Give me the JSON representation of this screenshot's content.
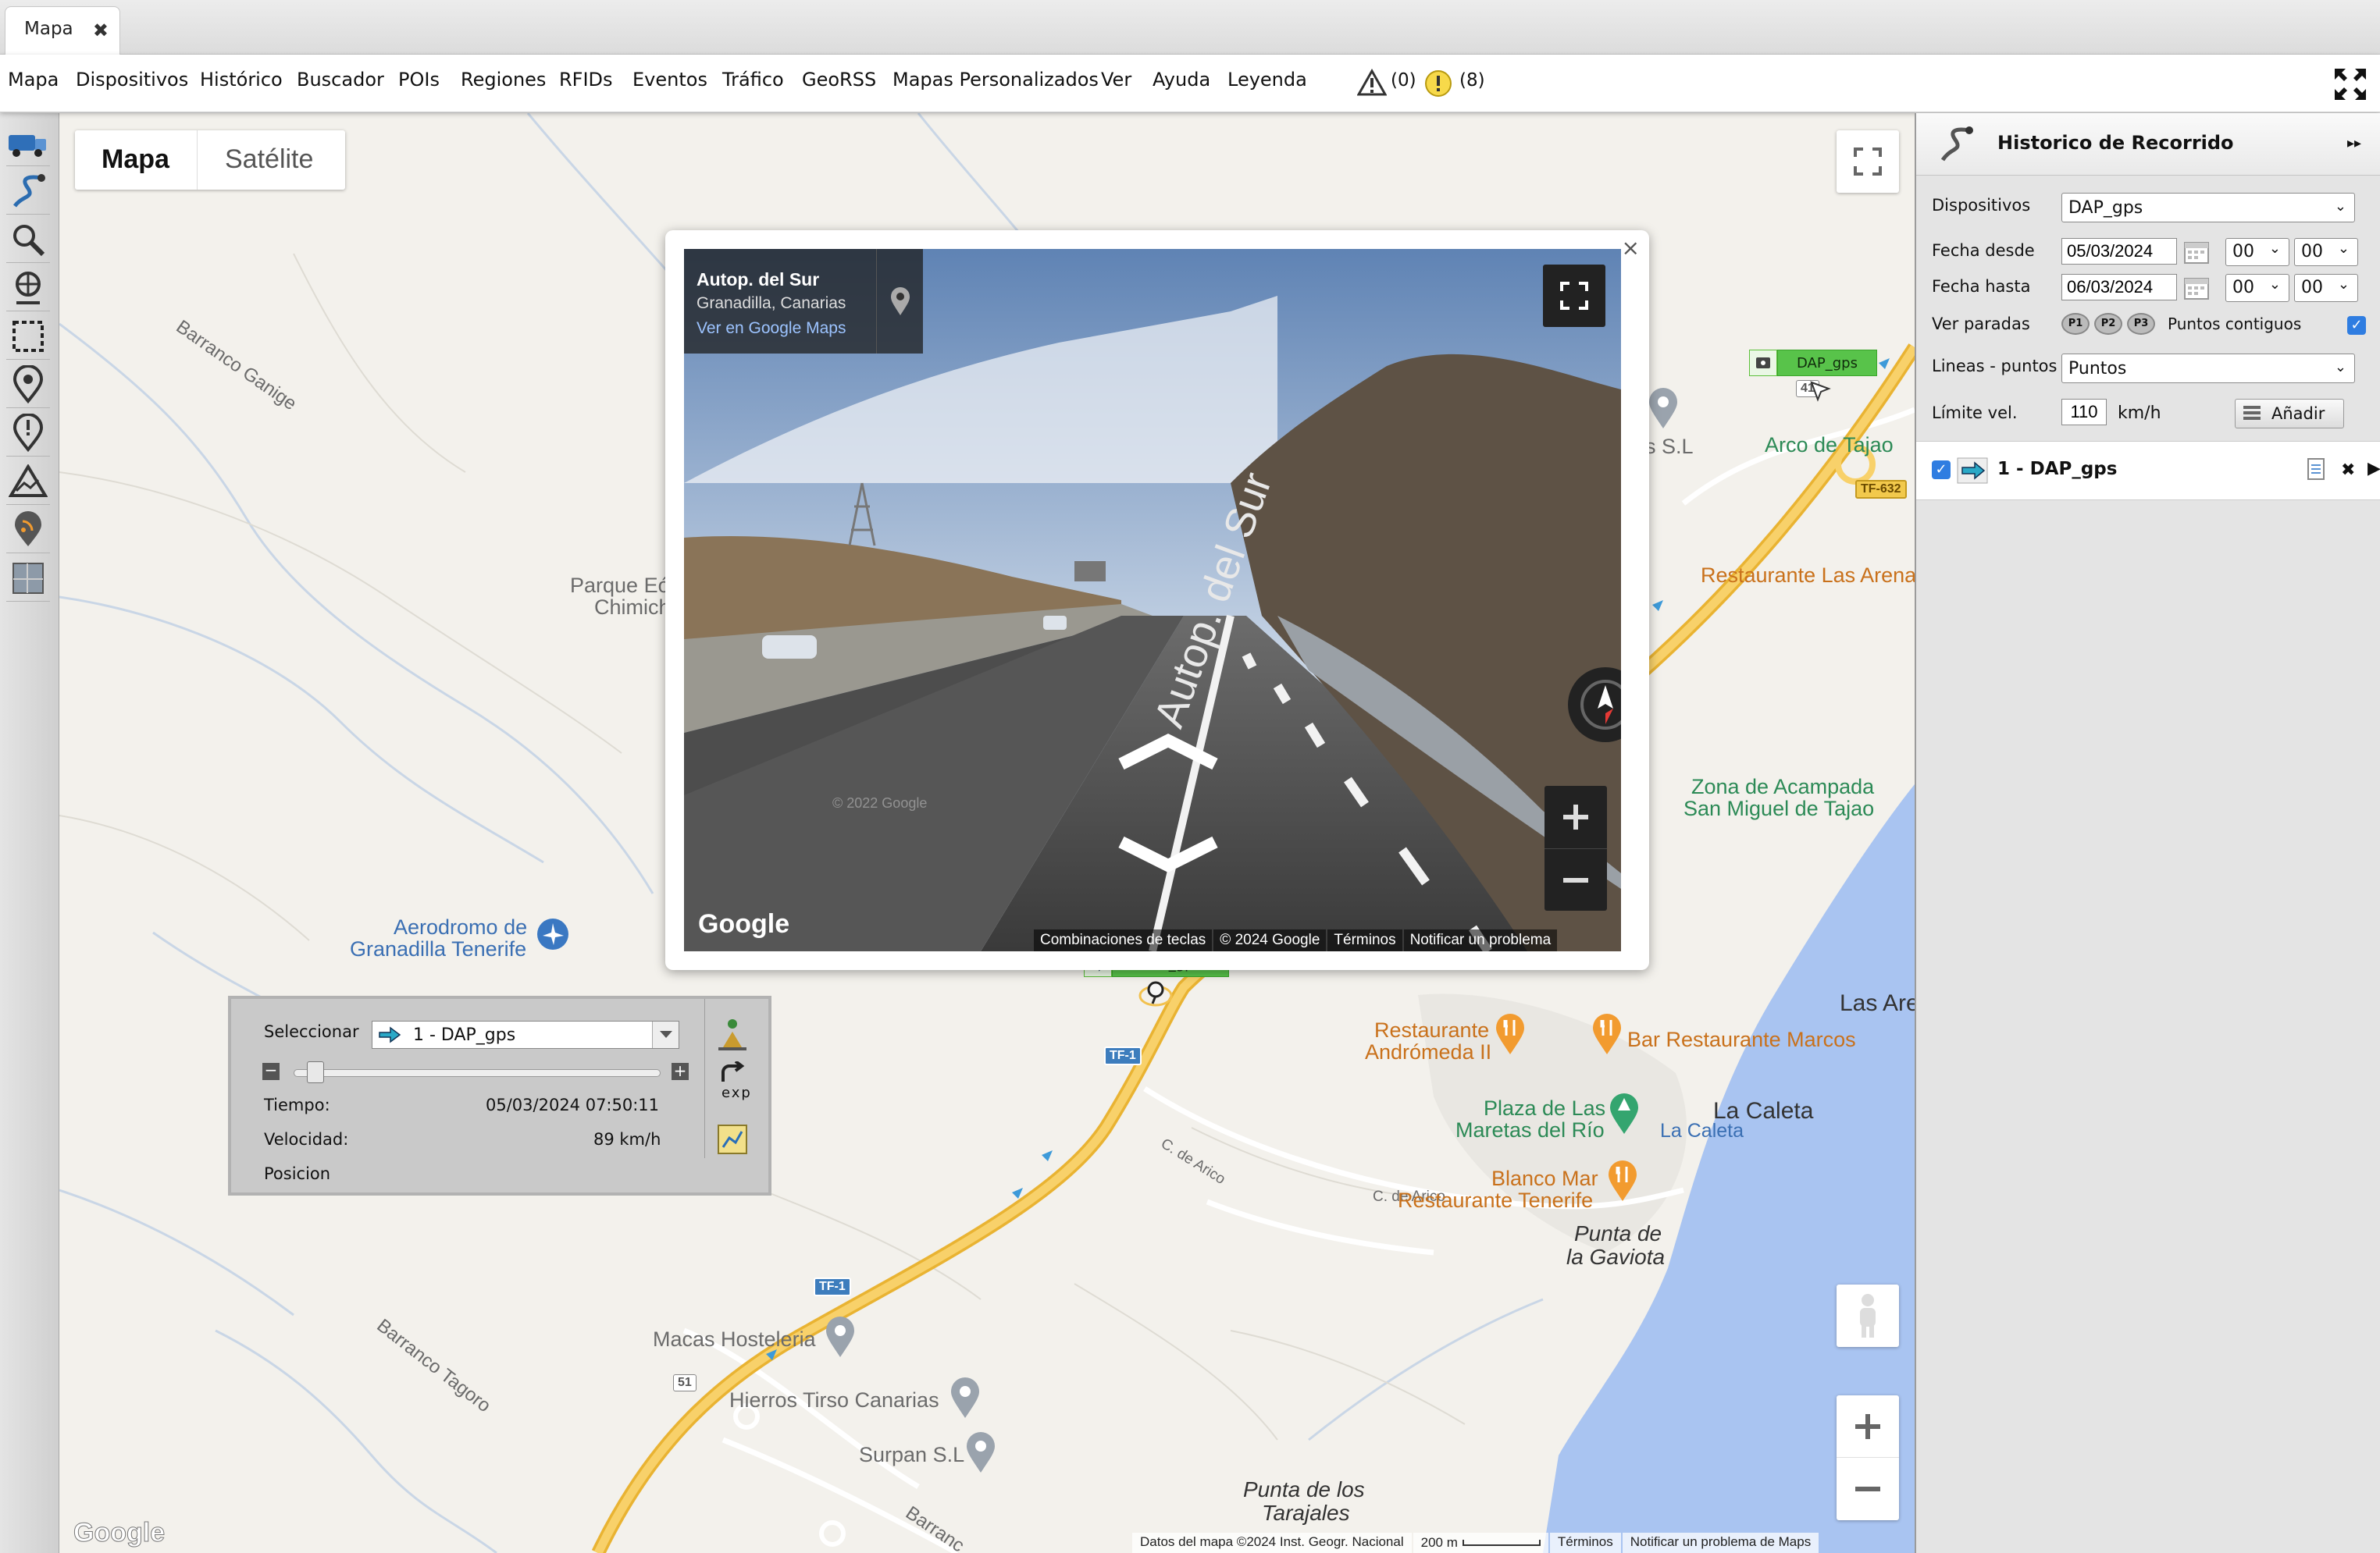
{
  "tab": {
    "label": "Mapa",
    "close": "✖"
  },
  "menu": {
    "items": [
      "Mapa",
      "Dispositivos",
      "Histórico",
      "Buscador",
      "POIs",
      "Regiones",
      "RFIDs",
      "Eventos",
      "Tráfico",
      "GeoRSS",
      "Mapas Personalizados",
      "Ver",
      "Ayuda",
      "Leyenda"
    ],
    "warnings_count": "(0)",
    "alerts_count": "(8)"
  },
  "map": {
    "type_options": [
      "Mapa",
      "Satélite"
    ],
    "selected_type": "Mapa",
    "labels": {
      "barranco_ganige": "Barranco Ganige",
      "parque_1": "Parque Eó",
      "parque_2": "Chimich",
      "aerodromo_1": "Aerodromo de",
      "aerodromo_2": "Granadilla Tenerife",
      "arco_tajao": "Arco de Tajao",
      "as_sl": "as S.L",
      "rest_las_arenas": "Restaurante Las Arena",
      "zona_acampada_1": "Zona de Acampada",
      "zona_acampada_2": "San Miguel de Tajao",
      "las_are": "Las Are",
      "la_caleta_town": "La Caleta",
      "rest_andromeda_1": "Restaurante",
      "rest_andromeda_2": "Andrómeda II",
      "bar_marcos": "Bar Restaurante Marcos",
      "c_arico_1": "C. de Arico",
      "c_arico_2": "C. de Arico",
      "plaza_1": "Plaza de Las",
      "plaza_2": "Maretas del Río",
      "la_caleta_beach": "La Caleta",
      "blanco_mar_1": "Blanco Mar",
      "blanco_mar_2": "Restaurante Tenerife",
      "punta_gaviota_1": "Punta de",
      "punta_gaviota_2": "la Gaviota",
      "macas": "Macas Hosteleria",
      "hierros": "Hierros Tirso Canarias",
      "surpan": "Surpan S.L",
      "barranco_tagoro": "Barranco Tagoro",
      "barranco_bottom": "Barranc",
      "punta_tarajales_1": "Punta de los",
      "punta_tarajales_2": "Tarajales",
      "road_tf1_a": "TF-1",
      "road_tf1_b": "TF-1",
      "road_tf632": "TF-632",
      "road_51": "51",
      "road_41": "41"
    },
    "attribution": {
      "datos": "Datos del mapa ©2024 Inst. Geogr. Nacional",
      "scale": "200 m",
      "terminos": "Términos",
      "notificar": "Notificar un problema de Maps"
    },
    "google_logo": "Google"
  },
  "streetview": {
    "road_name": "Autop. del Sur",
    "location": "Granadilla, Canarias",
    "maps_link": "Ver en Google Maps",
    "road_marking": "Autop. del Sur",
    "watermark": "© 2022 Google",
    "google_logo": "Google",
    "footer": [
      "Combinaciones de teclas",
      "© 2024 Google",
      "Términos",
      "Notificar un problema"
    ],
    "close": "×"
  },
  "device_markers": [
    {
      "name": "DAP_gps"
    },
    {
      "name": "DAP_gps"
    }
  ],
  "replay": {
    "select_label": "Seleccionar",
    "selected": "1 - DAP_gps",
    "time_label": "Tiempo:",
    "time_value": "05/03/2024 07:50:11",
    "speed_label": "Velocidad:",
    "speed_value": "89 km/h",
    "position_label": "Posicion",
    "exp_label": "exp",
    "minus": "−",
    "plus": "+",
    "progress": 0.06
  },
  "panel": {
    "title": "Historico de Recorrido",
    "collapse": "▸▸",
    "dispositivos_label": "Dispositivos",
    "dispositivos_value": "DAP_gps",
    "fecha_desde_label": "Fecha desde",
    "fecha_desde_value": "05/03/2024",
    "fecha_hasta_label": "Fecha hasta",
    "fecha_hasta_value": "06/03/2024",
    "hour_value": "00",
    "minute_value": "00",
    "ver_paradas_label": "Ver paradas",
    "paradas": [
      "P1",
      "P2",
      "P3"
    ],
    "puntos_contiguos_label": "Puntos contiguos",
    "lineas_label": "Lineas - puntos",
    "lineas_value": "Puntos",
    "limite_label": "Límite vel.",
    "limite_value": "110",
    "limite_unit": "km/h",
    "add_button": "Añadir",
    "track_label": "1 - DAP_gps",
    "track_close": "✖",
    "track_play": "▶"
  },
  "colors": {
    "accent_green": "#58c34a",
    "sea": "#a9c4f1",
    "highway": "#f5c04a"
  }
}
